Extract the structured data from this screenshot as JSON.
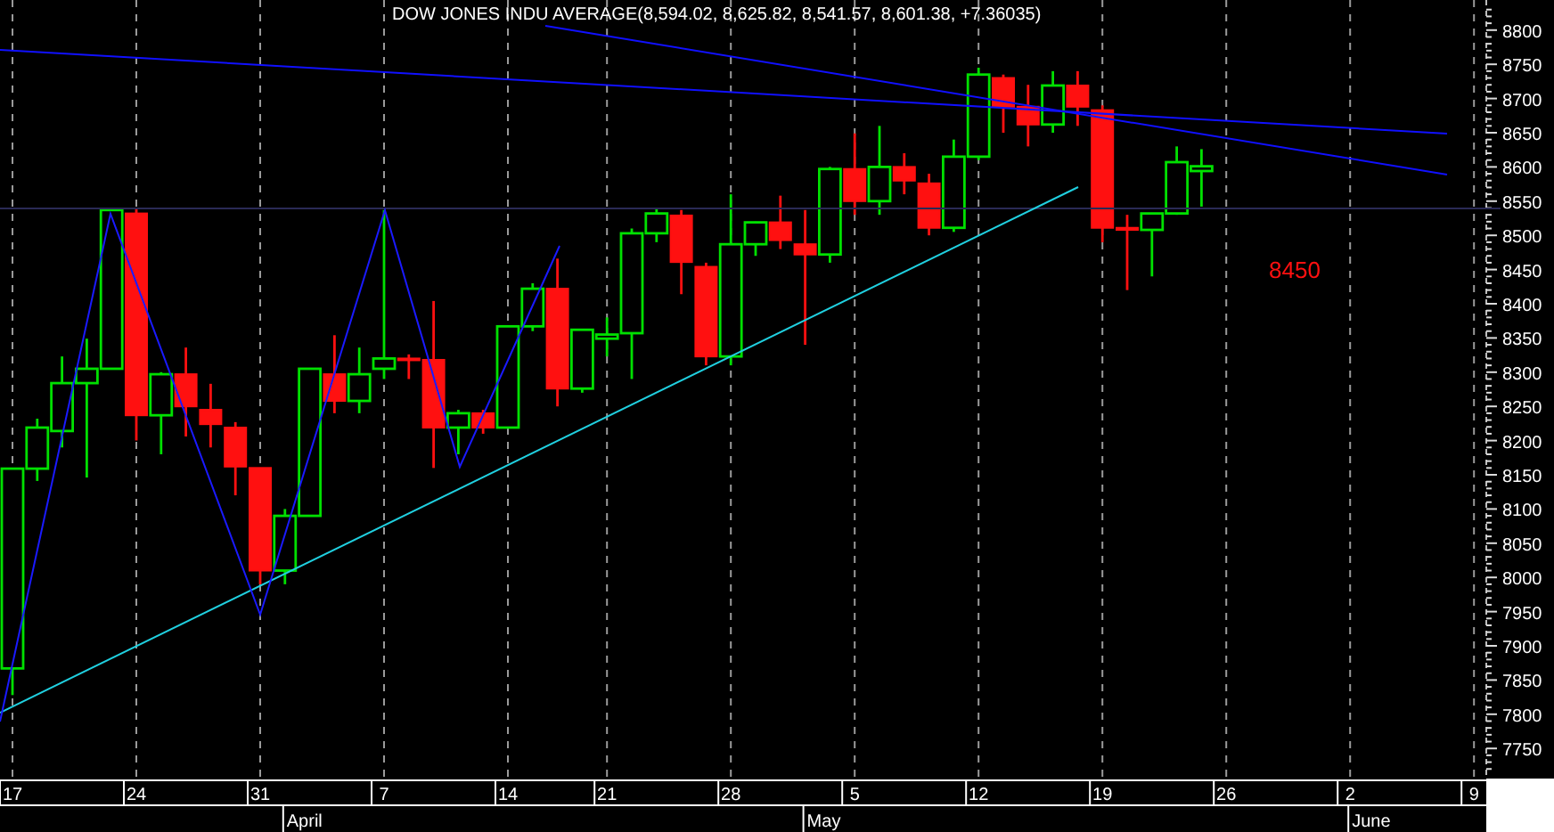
{
  "chart": {
    "chart_data": {
      "type": "candlestick",
      "title": "DOW JONES INDU AVERAGE(8,594.02, 8,625.82, 8,541.57, 8,601.38, +7.36035)",
      "grid": true,
      "ylim": [
        7706,
        8844
      ],
      "yticks": [
        7750,
        7800,
        7850,
        7900,
        7950,
        8000,
        8050,
        8100,
        8150,
        8200,
        8250,
        8300,
        8350,
        8400,
        8450,
        8500,
        8550,
        8600,
        8650,
        8700,
        8750,
        8800
      ],
      "categories": [
        "17",
        null,
        null,
        null,
        null,
        "24",
        null,
        null,
        null,
        null,
        "31",
        null,
        null,
        null,
        null,
        "7",
        null,
        null,
        null,
        null,
        "14",
        null,
        null,
        null,
        "21",
        null,
        null,
        null,
        null,
        "28",
        null,
        null,
        null,
        null,
        "5",
        null,
        null,
        null,
        null,
        "12",
        null,
        null,
        null,
        null,
        "19",
        null,
        null,
        null,
        null,
        "26",
        null,
        null,
        null,
        null,
        "2",
        null,
        null,
        null,
        null,
        "9"
      ],
      "ohlc": [
        [
          7867,
          8159,
          7828,
          8159
        ],
        [
          8159,
          8232,
          8141,
          8219
        ],
        [
          8214,
          8323,
          8190,
          8284
        ],
        [
          8284,
          8349,
          8146,
          8305
        ],
        [
          8305,
          8537,
          8305,
          8537
        ],
        [
          8532,
          8540,
          8200,
          8237
        ],
        [
          8237,
          8300,
          8180,
          8297
        ],
        [
          8297,
          8336,
          8206,
          8250
        ],
        [
          8245,
          8283,
          8190,
          8224
        ],
        [
          8219,
          8227,
          8120,
          8162
        ],
        [
          8160,
          8160,
          7990,
          8010
        ],
        [
          8010,
          8100,
          7990,
          8090
        ],
        [
          8090,
          8305,
          8090,
          8305
        ],
        [
          8297,
          8354,
          8240,
          8258
        ],
        [
          8258,
          8336,
          8240,
          8297
        ],
        [
          8305,
          8537,
          8290,
          8320
        ],
        [
          8320,
          8326,
          8290,
          8318
        ],
        [
          8318,
          8404,
          8160,
          8219
        ],
        [
          8219,
          8245,
          8180,
          8240
        ],
        [
          8240,
          8245,
          8210,
          8219
        ],
        [
          8219,
          8367,
          8219,
          8367
        ],
        [
          8367,
          8430,
          8360,
          8422
        ],
        [
          8422,
          8466,
          8250,
          8276
        ],
        [
          8276,
          8362,
          8270,
          8362
        ],
        [
          8349,
          8380,
          8323,
          8355
        ],
        [
          8357,
          8510,
          8290,
          8503
        ],
        [
          8503,
          8540,
          8490,
          8532
        ],
        [
          8529,
          8537,
          8414,
          8461
        ],
        [
          8454,
          8460,
          8310,
          8323
        ],
        [
          8323,
          8560,
          8310,
          8487
        ],
        [
          8487,
          8520,
          8470,
          8519
        ],
        [
          8519,
          8558,
          8480,
          8493
        ],
        [
          8487,
          8537,
          8340,
          8472
        ],
        [
          8472,
          8600,
          8460,
          8597
        ],
        [
          8597,
          8649,
          8530,
          8550
        ],
        [
          8550,
          8660,
          8530,
          8600
        ],
        [
          8600,
          8620,
          8560,
          8580
        ],
        [
          8576,
          8590,
          8500,
          8511
        ],
        [
          8511,
          8640,
          8505,
          8615
        ],
        [
          8615,
          8745,
          8610,
          8735
        ],
        [
          8730,
          8735,
          8650,
          8688
        ],
        [
          8688,
          8720,
          8630,
          8662
        ],
        [
          8662,
          8740,
          8650,
          8719
        ],
        [
          8719,
          8740,
          8660,
          8688
        ],
        [
          8683,
          8690,
          8490,
          8511
        ],
        [
          8511,
          8530,
          8420,
          8508
        ],
        [
          8508,
          8532,
          8440,
          8532
        ],
        [
          8532,
          8630,
          8530,
          8607
        ],
        [
          8594,
          8626,
          8542,
          8601
        ],
        null,
        null,
        null,
        null,
        null,
        null,
        null,
        null,
        null,
        null,
        null
      ],
      "annotations": [
        {
          "text": "8450"
        }
      ]
    },
    "month_labels": [
      "April",
      "May",
      "June"
    ]
  }
}
